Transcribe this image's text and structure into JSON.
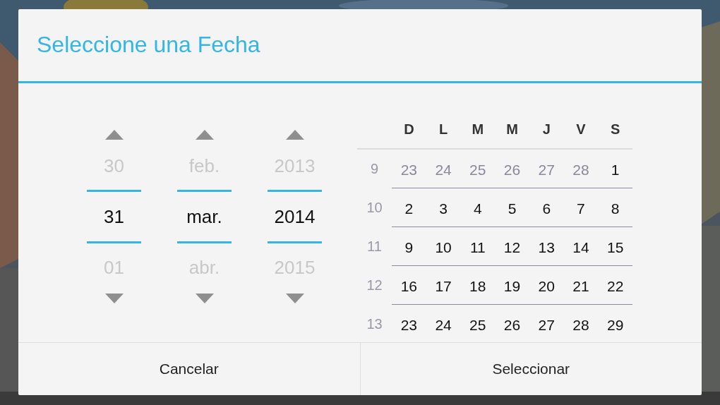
{
  "dialog": {
    "title": "Seleccione una Fecha",
    "spinners": [
      {
        "prev": "30",
        "current": "31",
        "next": "01"
      },
      {
        "prev": "feb.",
        "current": "mar.",
        "next": "abr."
      },
      {
        "prev": "2013",
        "current": "2014",
        "next": "2015"
      }
    ],
    "calendar": {
      "weekdays": [
        "D",
        "L",
        "M",
        "M",
        "J",
        "V",
        "S"
      ],
      "weeks": [
        {
          "week": "9",
          "days": [
            {
              "label": "23",
              "in_month": false
            },
            {
              "label": "24",
              "in_month": false
            },
            {
              "label": "25",
              "in_month": false
            },
            {
              "label": "26",
              "in_month": false
            },
            {
              "label": "27",
              "in_month": false
            },
            {
              "label": "28",
              "in_month": false
            },
            {
              "label": "1",
              "in_month": true
            }
          ]
        },
        {
          "week": "10",
          "days": [
            {
              "label": "2",
              "in_month": true
            },
            {
              "label": "3",
              "in_month": true
            },
            {
              "label": "4",
              "in_month": true
            },
            {
              "label": "5",
              "in_month": true
            },
            {
              "label": "6",
              "in_month": true
            },
            {
              "label": "7",
              "in_month": true
            },
            {
              "label": "8",
              "in_month": true
            }
          ]
        },
        {
          "week": "11",
          "days": [
            {
              "label": "9",
              "in_month": true
            },
            {
              "label": "10",
              "in_month": true
            },
            {
              "label": "11",
              "in_month": true
            },
            {
              "label": "12",
              "in_month": true
            },
            {
              "label": "13",
              "in_month": true
            },
            {
              "label": "14",
              "in_month": true
            },
            {
              "label": "15",
              "in_month": true
            }
          ]
        },
        {
          "week": "12",
          "days": [
            {
              "label": "16",
              "in_month": true
            },
            {
              "label": "17",
              "in_month": true
            },
            {
              "label": "18",
              "in_month": true
            },
            {
              "label": "19",
              "in_month": true
            },
            {
              "label": "20",
              "in_month": true
            },
            {
              "label": "21",
              "in_month": true
            },
            {
              "label": "22",
              "in_month": true
            }
          ]
        },
        {
          "week": "13",
          "days": [
            {
              "label": "23",
              "in_month": true
            },
            {
              "label": "24",
              "in_month": true
            },
            {
              "label": "25",
              "in_month": true
            },
            {
              "label": "26",
              "in_month": true
            },
            {
              "label": "27",
              "in_month": true
            },
            {
              "label": "28",
              "in_month": true
            },
            {
              "label": "29",
              "in_month": true
            }
          ]
        }
      ]
    },
    "buttons": [
      "Cancelar",
      "Seleccionar"
    ]
  }
}
